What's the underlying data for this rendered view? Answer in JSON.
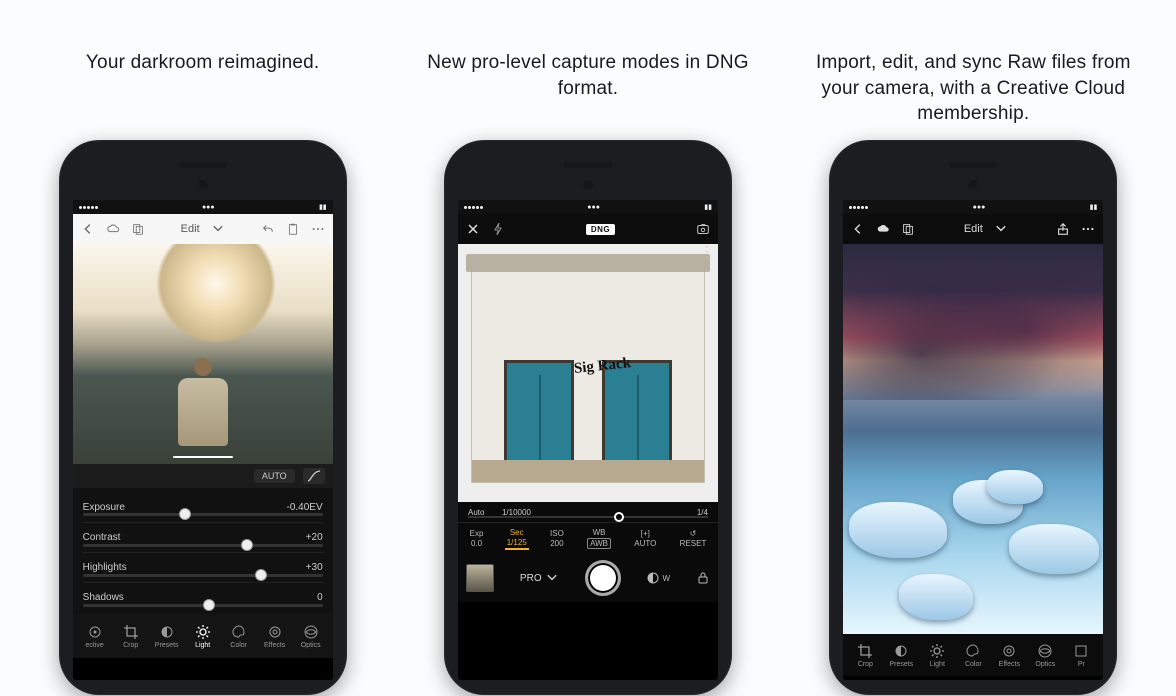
{
  "captions": {
    "c1": "Your darkroom reimagined.",
    "c2": "New pro-level capture modes in DNG format.",
    "c3": "Import, edit, and sync Raw files from your camera, with a Creative Cloud membership."
  },
  "phone1": {
    "topbar": {
      "title": "Edit"
    },
    "auto_label": "AUTO",
    "sliders": [
      {
        "label": "Exposure",
        "value": "-0.40EV",
        "thumb": 40
      },
      {
        "label": "Contrast",
        "value": "+20",
        "thumb": 66
      },
      {
        "label": "Highlights",
        "value": "+30",
        "thumb": 72
      },
      {
        "label": "Shadows",
        "value": "0",
        "thumb": 50
      }
    ],
    "bottom": [
      "ective",
      "Crop",
      "Presets",
      "Light",
      "Color",
      "Effects",
      "Optics"
    ],
    "bottom_active_index": 3
  },
  "phone2": {
    "format_badge": "DNG",
    "graffiti": "Sig\nRack",
    "strip1": {
      "left": "Auto",
      "mid": "1/10000",
      "right": "1/4",
      "thumb": 60
    },
    "strip2": [
      {
        "t1": "Exp",
        "t2": "0.0"
      },
      {
        "t1": "Sec",
        "t2": "1/125",
        "active": true
      },
      {
        "t1": "ISO",
        "t2": "200"
      },
      {
        "t1": "WB",
        "t2": "AWB",
        "awb": true
      },
      {
        "t1": "[+]",
        "t2": "AUTO"
      },
      {
        "t1": "↺",
        "t2": "RESET"
      }
    ],
    "strip3": {
      "mode": "PRO",
      "wb_label": "W",
      "lock_label": ""
    }
  },
  "phone3": {
    "topbar": {
      "title": "Edit"
    },
    "bottom": [
      "Crop",
      "Presets",
      "Light",
      "Color",
      "Effects",
      "Optics",
      "Pr"
    ]
  }
}
